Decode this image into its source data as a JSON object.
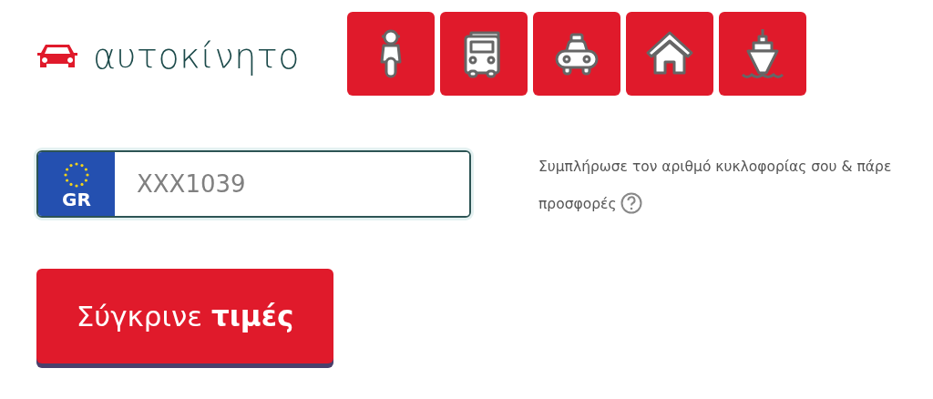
{
  "header": {
    "title": "αυτοκίνητο"
  },
  "vehicle_tabs": [
    {
      "kind": "scooter"
    },
    {
      "kind": "truck"
    },
    {
      "kind": "taxi"
    },
    {
      "kind": "home"
    },
    {
      "kind": "ship"
    }
  ],
  "plate": {
    "country": "GR",
    "placeholder": "XXX1039"
  },
  "hint": "Συμπλήρωσε τον αριθμό κυκλοφορίας σου & πάρε προσφορές",
  "submit": "Σύγκρινε **τιμές**"
}
